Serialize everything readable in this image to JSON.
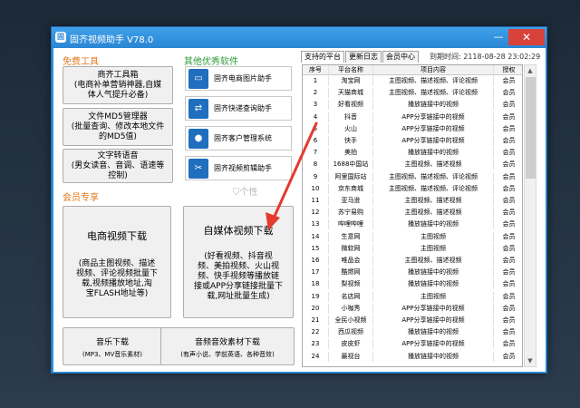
{
  "window": {
    "title": "固齐视频助手 V78.0",
    "app_icon": "app-icon",
    "minimize": "—",
    "close": "✕"
  },
  "sections": {
    "free": "免费工具",
    "other": "其他优秀软件",
    "vip": "会员专享"
  },
  "free_tools": [
    {
      "label": "商齐工具箱\n(电商补单营销神器,自媒\n体人气提升必备)"
    },
    {
      "label": "文件MD5管理器\n(批量查询、修改本地文件\n的MD5值)"
    },
    {
      "label": "文字转语音\n(男女读音、音调、语速等\n控制)"
    }
  ],
  "other_apps": [
    {
      "label": "固齐电商图片助手",
      "icon": "monitor-icon"
    },
    {
      "label": "固齐快递查询助手",
      "icon": "delivery-icon"
    },
    {
      "label": "固齐客户管理系统",
      "icon": "user-icon"
    },
    {
      "label": "固齐视频剪辑助手",
      "icon": "scissors-icon"
    }
  ],
  "watermark": "个性",
  "vip_tools": {
    "ecommerce": {
      "title": "电商视频下载",
      "desc": "(商品主图视频、描述\n视频、评论视频批量下\n载,视频播放地址,淘\n宝FLASH地址等)"
    },
    "selfmedia": {
      "title": "自媒体视频下载",
      "desc": "(好看视频、抖音视\n频、美拍视频、火山视\n频、快手视频等播放链\n接或APP分享链接批量下\n载,网址批量生成)"
    },
    "music": {
      "title": "音乐下载",
      "desc": "(MP3、MV音乐素材)"
    },
    "audio": {
      "title": "音频音效素材下载",
      "desc": "(有声小说、学前英语、各种音效)"
    }
  },
  "tabs": [
    "支持的平台",
    "更新日志",
    "会员中心"
  ],
  "expire_label": "到期时间: 2118-08-28 23:02:29",
  "table": {
    "headers": [
      "序号",
      "平台名称",
      "项目内容",
      "授权"
    ],
    "rows": [
      [
        "1",
        "淘宝网",
        "主图视频、描述视频、评论视频",
        "会员"
      ],
      [
        "2",
        "天猫商城",
        "主图视频、描述视频、评论视频",
        "会员"
      ],
      [
        "3",
        "好看视频",
        "播放链接中的视频",
        "会员"
      ],
      [
        "4",
        "抖音",
        "APP分享链接中的视频",
        "会员"
      ],
      [
        "5",
        "火山",
        "APP分享链接中的视频",
        "会员"
      ],
      [
        "6",
        "快手",
        "APP分享链接中的视频",
        "会员"
      ],
      [
        "7",
        "美拍",
        "播放链接中的视频",
        "会员"
      ],
      [
        "8",
        "1688中国站",
        "主图视频、描述视频",
        "会员"
      ],
      [
        "9",
        "阿里国际站",
        "主图视频、描述视频、评论视频",
        "会员"
      ],
      [
        "10",
        "京东商城",
        "主图视频、描述视频、评论视频",
        "会员"
      ],
      [
        "11",
        "亚马逊",
        "主图视频、描述视频",
        "会员"
      ],
      [
        "12",
        "苏宁易购",
        "主图视频、描述视频",
        "会员"
      ],
      [
        "13",
        "哔哩哔哩",
        "播放链接中的视频",
        "会员"
      ],
      [
        "14",
        "生意网",
        "主图视频",
        "会员"
      ],
      [
        "15",
        "微软网",
        "主图视频",
        "会员"
      ],
      [
        "16",
        "唯品会",
        "主图视频、描述视频",
        "会员"
      ],
      [
        "17",
        "酷燃网",
        "播放链接中的视频",
        "会员"
      ],
      [
        "18",
        "梨视频",
        "播放链接中的视频",
        "会员"
      ],
      [
        "19",
        "名店网",
        "主图视频",
        "会员"
      ],
      [
        "20",
        "小咖秀",
        "APP分享链接中的视频",
        "会员"
      ],
      [
        "21",
        "全民小视频",
        "APP分享链接中的视频",
        "会员"
      ],
      [
        "22",
        "西瓜视频",
        "播放链接中的视频",
        "会员"
      ],
      [
        "23",
        "皮皮虾",
        "APP分享链接中的视频",
        "会员"
      ],
      [
        "24",
        "最视台",
        "播放链接中的视频",
        "会员"
      ]
    ]
  },
  "colors": {
    "accent": "#2f8fdc",
    "close": "#d9413b",
    "section_orange": "#e0771a",
    "section_green": "#2a9a32",
    "arrow": "#e53a2c"
  }
}
